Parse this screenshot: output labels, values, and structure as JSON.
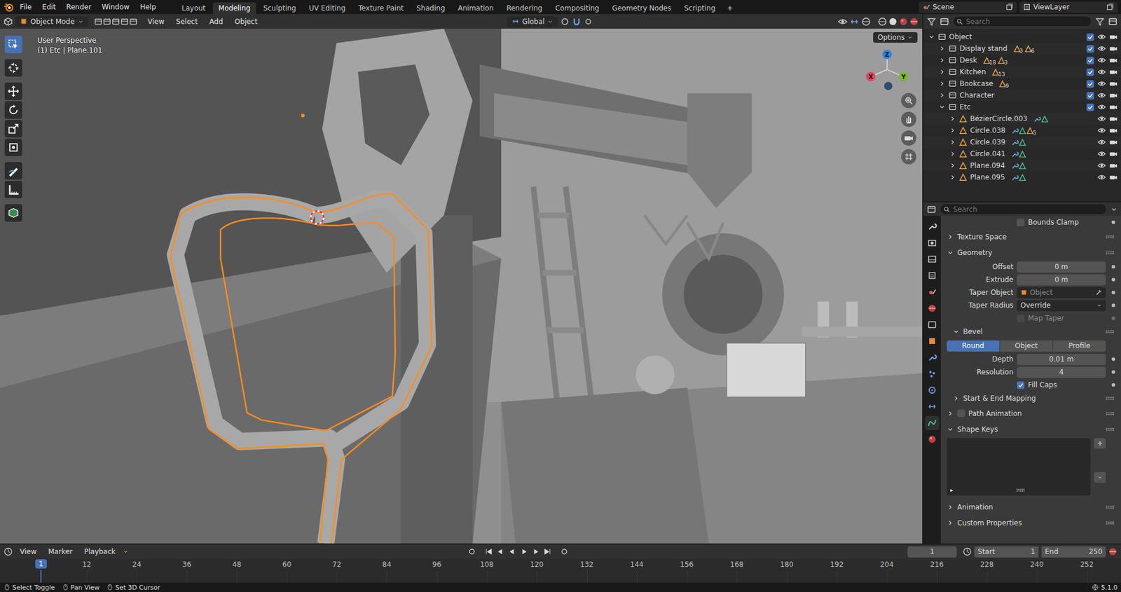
{
  "topbar": {
    "menus": [
      "File",
      "Edit",
      "Render",
      "Window",
      "Help"
    ],
    "workspaces": [
      {
        "label": "Layout",
        "selected": false
      },
      {
        "label": "Modeling",
        "selected": true
      },
      {
        "label": "Sculpting",
        "selected": false
      },
      {
        "label": "UV Editing",
        "selected": false
      },
      {
        "label": "Texture Paint",
        "selected": false
      },
      {
        "label": "Shading",
        "selected": false
      },
      {
        "label": "Animation",
        "selected": false
      },
      {
        "label": "Rendering",
        "selected": false
      },
      {
        "label": "Compositing",
        "selected": false
      },
      {
        "label": "Geometry Nodes",
        "selected": false
      },
      {
        "label": "Scripting",
        "selected": false
      }
    ],
    "add_workspace": "+",
    "scene": "Scene",
    "view_layer": "ViewLayer"
  },
  "viewport": {
    "mode": "Object Mode",
    "menus": [
      "View",
      "Select",
      "Add",
      "Object"
    ],
    "orientation": "Global",
    "options": "Options",
    "perspective": "User Perspective",
    "context": "(1) Etc | Plane.101",
    "gizmo_axes": [
      "X",
      "Y",
      "Z"
    ],
    "tools": [
      {
        "kind": "select",
        "selected": true
      },
      {
        "kind": "cursor",
        "selected": false
      },
      {
        "kind": "move",
        "selected": false
      },
      {
        "kind": "rotate",
        "selected": false
      },
      {
        "kind": "scale",
        "selected": false
      },
      {
        "kind": "transform",
        "selected": false
      },
      {
        "kind": "annotate",
        "selected": false
      },
      {
        "kind": "measure",
        "selected": false
      },
      {
        "kind": "add_cube",
        "selected": false
      }
    ]
  },
  "outliner": {
    "search_placeholder": "Search",
    "rows": [
      {
        "label": "Object",
        "kind": "collection",
        "depth": 0,
        "expanded": true,
        "checked": true,
        "visible": true,
        "counts": []
      },
      {
        "label": "Display stand",
        "kind": "collection",
        "depth": 1,
        "expanded": false,
        "checked": true,
        "visible": true,
        "counts": [
          "3",
          "6"
        ]
      },
      {
        "label": "Desk",
        "kind": "collection",
        "depth": 1,
        "expanded": false,
        "checked": true,
        "visible": true,
        "counts": [
          "18",
          "3"
        ]
      },
      {
        "label": "Kitchen",
        "kind": "collection",
        "depth": 1,
        "expanded": false,
        "checked": true,
        "visible": true,
        "counts": [
          "13"
        ]
      },
      {
        "label": "Bookcase",
        "kind": "collection",
        "depth": 1,
        "expanded": false,
        "checked": true,
        "visible": true,
        "counts": [
          "9"
        ]
      },
      {
        "label": "Character",
        "kind": "collection",
        "depth": 1,
        "expanded": false,
        "checked": true,
        "visible": true,
        "counts": []
      },
      {
        "label": "Etc",
        "kind": "collection",
        "depth": 1,
        "expanded": true,
        "checked": true,
        "visible": true,
        "counts": []
      },
      {
        "label": "BézierCircle.003",
        "kind": "object",
        "depth": 2,
        "expanded": false,
        "visible": true,
        "counts": []
      },
      {
        "label": "Circle.038",
        "kind": "object",
        "depth": 2,
        "expanded": false,
        "visible": true,
        "counts": [
          "5"
        ]
      },
      {
        "label": "Circle.039",
        "kind": "object",
        "depth": 2,
        "expanded": false,
        "visible": true,
        "counts": []
      },
      {
        "label": "Circle.041",
        "kind": "object",
        "depth": 2,
        "expanded": false,
        "visible": true,
        "counts": []
      },
      {
        "label": "Plane.094",
        "kind": "object",
        "depth": 2,
        "expanded": false,
        "visible": true,
        "counts": []
      },
      {
        "label": "Plane.095",
        "kind": "object",
        "depth": 2,
        "expanded": false,
        "visible": true,
        "counts": []
      }
    ]
  },
  "properties": {
    "search_placeholder": "Search",
    "tabs": [
      {
        "kind": "tool",
        "selected": false
      },
      {
        "kind": "render",
        "selected": false
      },
      {
        "kind": "output",
        "selected": false
      },
      {
        "kind": "view_layer",
        "selected": false
      },
      {
        "kind": "scene",
        "selected": false
      },
      {
        "kind": "world",
        "selected": false
      },
      {
        "kind": "collection",
        "selected": false
      },
      {
        "kind": "object",
        "selected": false
      },
      {
        "kind": "modifiers",
        "selected": false
      },
      {
        "kind": "particles",
        "selected": false
      },
      {
        "kind": "physics",
        "selected": false
      },
      {
        "kind": "constraints",
        "selected": false
      },
      {
        "kind": "data",
        "selected": true
      },
      {
        "kind": "material",
        "selected": false
      }
    ],
    "items": [
      {
        "kind": "checkbox",
        "label": "Bounds Clamp",
        "checked": false,
        "disabled": false
      },
      {
        "kind": "panel",
        "label": "Texture Space",
        "expanded": false
      },
      {
        "kind": "panel",
        "label": "Geometry",
        "expanded": true
      },
      {
        "kind": "number",
        "label": "Offset",
        "value": "0 m"
      },
      {
        "kind": "number",
        "label": "Extrude",
        "value": "0 m"
      },
      {
        "kind": "object",
        "label": "Taper Object",
        "placeholder": "Object"
      },
      {
        "kind": "dropdown",
        "label": "Taper Radius",
        "value": "Override"
      },
      {
        "kind": "checkbox",
        "label": "Map Taper",
        "checked": false,
        "disabled": true
      },
      {
        "kind": "subpanel",
        "label": "Bevel",
        "expanded": true
      },
      {
        "kind": "segmented",
        "options": [
          {
            "label": "Round",
            "selected": true
          },
          {
            "label": "Object",
            "selected": false
          },
          {
            "label": "Profile",
            "selected": false
          }
        ]
      },
      {
        "kind": "number",
        "label": "Depth",
        "value": "0.01 m"
      },
      {
        "kind": "number",
        "label": "Resolution",
        "value": "4"
      },
      {
        "kind": "checkbox",
        "label": "Fill Caps",
        "checked": true,
        "disabled": false
      },
      {
        "kind": "subpanel",
        "label": "Start & End Mapping",
        "expanded": false
      },
      {
        "kind": "panel",
        "label": "Path Animation",
        "expanded": false,
        "checked": false
      },
      {
        "kind": "panel",
        "label": "Shape Keys",
        "expanded": true
      },
      {
        "kind": "list",
        "add": "+",
        "expand": "▸"
      },
      {
        "kind": "panel",
        "label": "Animation",
        "expanded": false
      },
      {
        "kind": "panel",
        "label": "Custom Properties",
        "expanded": false
      }
    ]
  },
  "timeline": {
    "menus": [
      "View",
      "Marker",
      "Playback"
    ],
    "current_frame": "1",
    "start_label": "Start",
    "start": "1",
    "end_label": "End",
    "end": "250",
    "playhead": "1",
    "ticks": [
      "12",
      "24",
      "36",
      "48",
      "60",
      "72",
      "84",
      "96",
      "108",
      "120",
      "132",
      "144",
      "156",
      "168",
      "180",
      "192",
      "204",
      "216",
      "228",
      "240",
      "252"
    ]
  },
  "status": {
    "hints": [
      "Select Toggle",
      "Pan View",
      "Set 3D Cursor"
    ],
    "version": "5.1.0"
  }
}
